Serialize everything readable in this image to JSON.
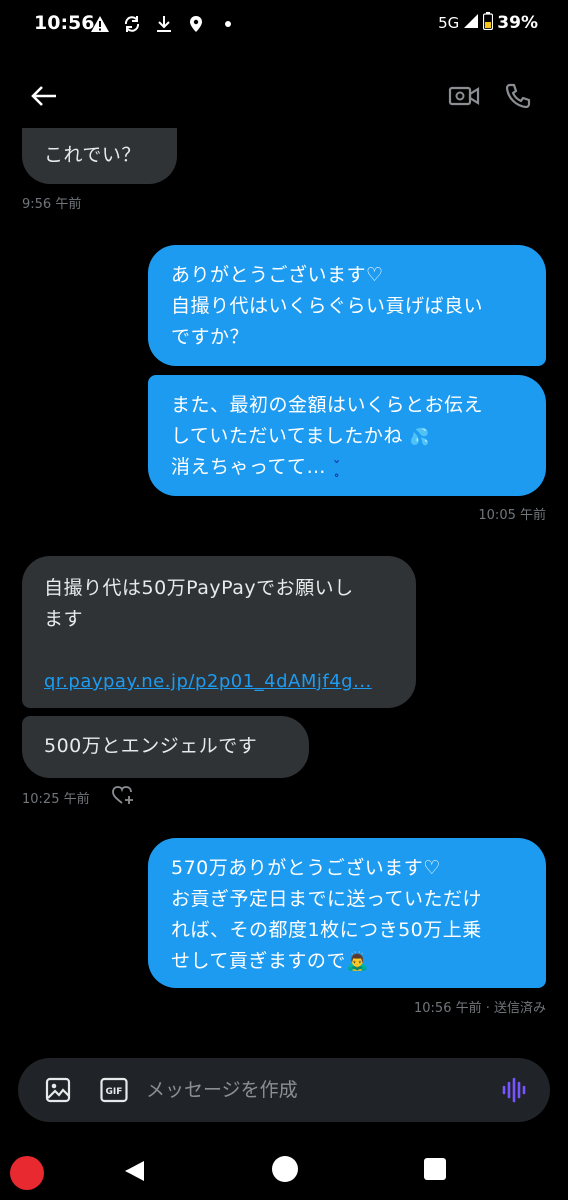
{
  "status_bar": {
    "time": "10:56",
    "network": "5G",
    "battery": "39%",
    "icons": [
      "warning-icon",
      "sync-icon",
      "download-icon",
      "location-icon",
      "dot-icon",
      "signal-icon",
      "battery-icon"
    ]
  },
  "header": {
    "icons": [
      "back-arrow-icon",
      "video-call-icon",
      "phone-call-icon"
    ]
  },
  "messages": {
    "m1": {
      "text": "これでい？"
    },
    "m1_time": "9:56 午前",
    "m2": {
      "line1": "ありがとうございます♡",
      "line2": "自撮り代はいくらぐらい貢げば良い",
      "line3": "ですか？"
    },
    "m3": {
      "line1": "また、最初の金額はいくらとお伝え",
      "line2": "していただいてましたかね",
      "line3": "消えちゃってて…",
      "emoji1": "💦",
      "emoji2": "ˇ̥"
    },
    "m3_time": "10:05 午前",
    "m4": {
      "line1": "自撮り代は50万PayPayでお願いし",
      "line2": "ます",
      "link": "qr.paypay.ne.jp/p2p01_4dAMjf4g..."
    },
    "m5": {
      "text": "500万とエンジェルです"
    },
    "m5_time": "10:25 午前",
    "m6": {
      "line1": "570万ありがとうございます♡",
      "line2": "お貢ぎ予定日までに送っていただけ",
      "line3": "れば、その都度1枚につき50万上乗",
      "line4": "せして貢ぎますので",
      "emoji": "🙇‍♂️"
    },
    "m6_meta": "10:56 午前 · 送信済み"
  },
  "composer": {
    "placeholder": "メッセージを作成",
    "icons": [
      "image-icon",
      "gif-icon",
      "voice-icon"
    ],
    "voice_color": "#7856ff"
  },
  "colors": {
    "sent_bubble": "#1d9bf0",
    "received_bubble": "#2f3336",
    "background": "#000000"
  }
}
